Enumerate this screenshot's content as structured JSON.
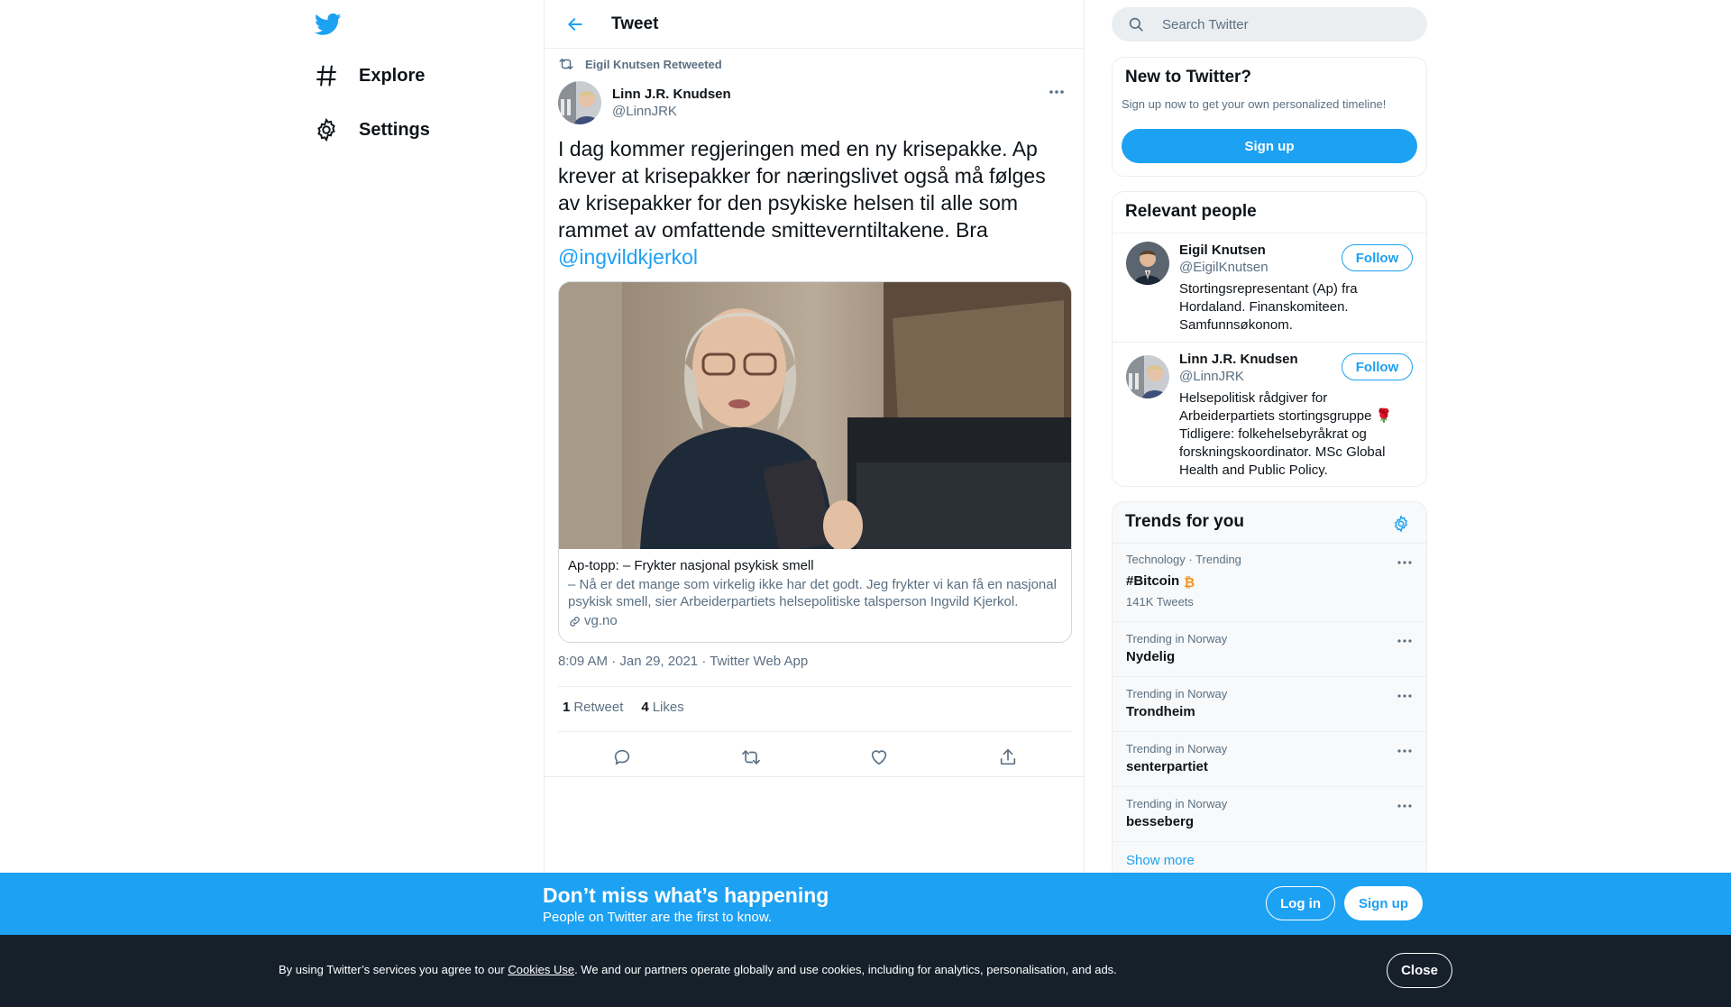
{
  "nav": {
    "logo_icon": "twitter-bird-icon",
    "items": [
      {
        "label": "Explore",
        "icon": "hashtag-icon"
      },
      {
        "label": "Settings",
        "icon": "gear-icon"
      }
    ]
  },
  "header": {
    "title": "Tweet",
    "back_icon": "arrow-left-icon"
  },
  "tweet": {
    "retweeted_by": "Eigil Knutsen Retweeted",
    "author_name": "Linn J.R. Knudsen",
    "author_handle": "@LinnJRK",
    "text": "I dag kommer regjeringen med en ny krisepakke. Ap krever at krisepakker for næringslivet også må følges av krisepakker for den psykiske helsen til alle som rammet av omfattende smitteverntiltakene. Bra ",
    "mention": "@ingvildkjerkol",
    "card": {
      "title": "Ap-topp: – Frykter nasjonal psykisk smell",
      "description": "– Nå er det mange som virkelig ikke har det godt. Jeg frykter vi kan få en nasjonal psykisk smell, sier Arbeiderpartiets helsepolitiske talsperson Ingvild Kjerkol.",
      "domain": "vg.no"
    },
    "time": "8:09 AM",
    "date": "Jan 29, 2021",
    "source": "Twitter Web App",
    "sep": "·",
    "retweet_count": "1",
    "retweet_label": "Retweet",
    "like_count": "4",
    "like_label": "Likes"
  },
  "search": {
    "placeholder": "Search Twitter"
  },
  "new_to_twitter": {
    "title": "New to Twitter?",
    "subtitle": "Sign up now to get your own personalized timeline!",
    "button": "Sign up"
  },
  "relevant": {
    "title": "Relevant people",
    "people": [
      {
        "name": "Eigil Knutsen",
        "handle": "@EigilKnutsen",
        "bio": "Stortingsrepresentant (Ap) fra Hordaland. Finanskomiteen. Samfunnsøkonom.",
        "follow": "Follow"
      },
      {
        "name": "Linn J.R. Knudsen",
        "handle": "@LinnJRK",
        "bio": "Helsepolitisk rådgiver for Arbeiderpartiets stortingsgruppe 🌹 Tidligere: folkehelsebyråkrat og forskningskoordinator. MSc Global Health and Public Policy.",
        "follow": "Follow"
      }
    ]
  },
  "trends": {
    "title": "Trends for you",
    "items": [
      {
        "meta": "Technology · Trending",
        "name": "#Bitcoin",
        "count": "141K Tweets"
      },
      {
        "meta": "Trending in Norway",
        "name": "Nydelig"
      },
      {
        "meta": "Trending in Norway",
        "name": "Trondheim"
      },
      {
        "meta": "Trending in Norway",
        "name": "senterpartiet"
      },
      {
        "meta": "Trending in Norway",
        "name": "besseberg"
      }
    ],
    "show_more": "Show more"
  },
  "banner": {
    "title": "Don’t miss what’s happening",
    "subtitle": "People on Twitter are the first to know.",
    "login": "Log in",
    "signup": "Sign up"
  },
  "cookie": {
    "text_before": "By using Twitter’s services you agree to our ",
    "link": "Cookies Use",
    "text_after": ". We and our partners operate globally and use cookies, including for analytics, personalisation, and ads.",
    "close": "Close"
  },
  "colors": {
    "accent": "#1da1f2",
    "text": "#0f1419",
    "secondary": "#5b7083",
    "cookie_bg": "#15202b"
  }
}
